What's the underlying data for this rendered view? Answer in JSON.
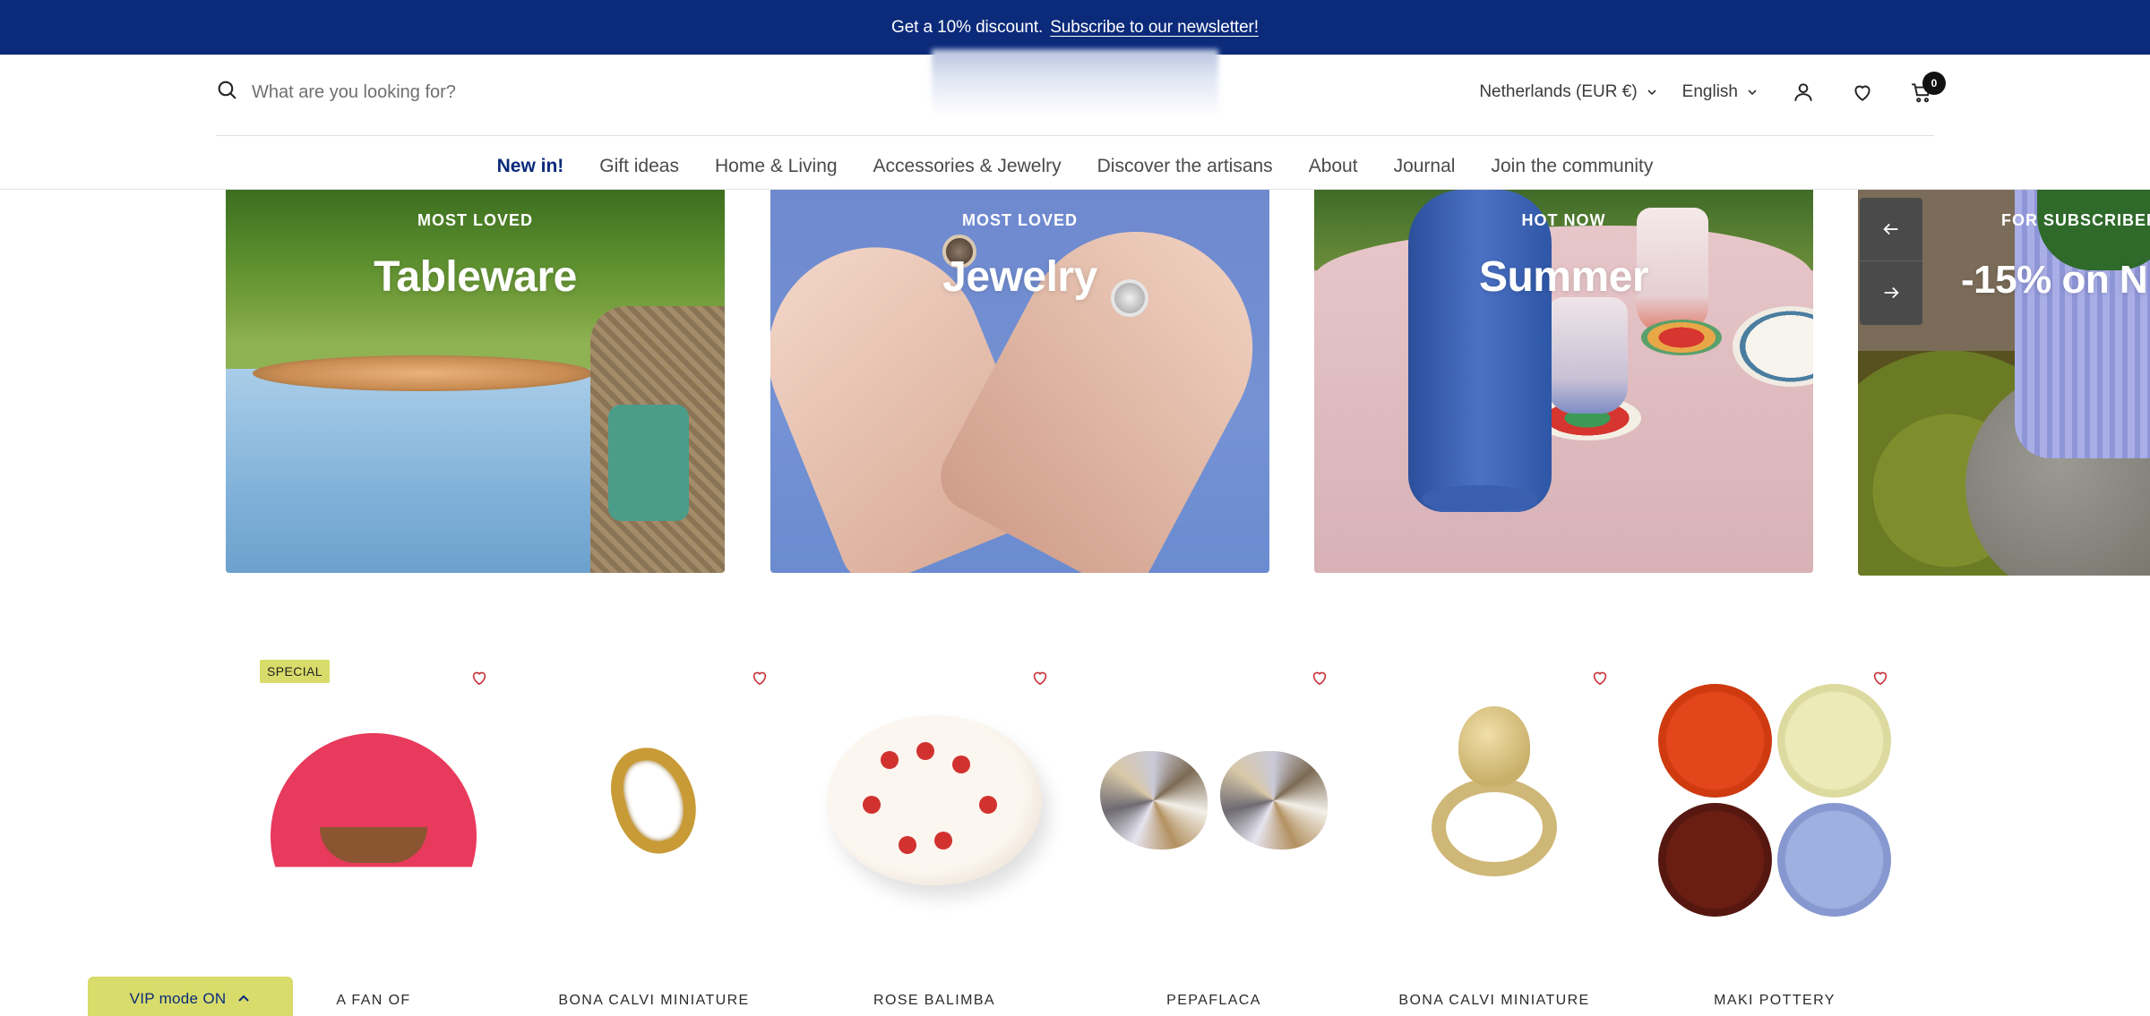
{
  "announcement": {
    "text": "Get a 10% discount.",
    "link": "Subscribe to our newsletter!"
  },
  "header": {
    "search_placeholder": "What are you looking for?",
    "country_selector": "Netherlands (EUR €)",
    "language_selector": "English",
    "cart_count": "0",
    "icons": [
      "search-icon",
      "chevron-down-icon",
      "account-icon",
      "heart-icon",
      "cart-icon"
    ]
  },
  "nav": {
    "items": [
      {
        "label": "New in!",
        "active": true
      },
      {
        "label": "Gift ideas"
      },
      {
        "label": "Home & Living"
      },
      {
        "label": "Accessories & Jewelry"
      },
      {
        "label": "Discover the artisans"
      },
      {
        "label": "About"
      },
      {
        "label": "Journal"
      },
      {
        "label": "Join the community"
      }
    ]
  },
  "hero": {
    "slides": [
      {
        "eyebrow": "MOST LOVED",
        "title": "Tableware"
      },
      {
        "eyebrow": "MOST LOVED",
        "title": "Jewelry"
      },
      {
        "eyebrow": "HOT NOW",
        "title": "Summer"
      },
      {
        "eyebrow": "FOR SUBSCRIBER",
        "title": "-15% on N"
      }
    ],
    "controls": [
      "arrow-left-icon",
      "arrow-right-icon"
    ]
  },
  "products": [
    {
      "vendor": "A FAN OF",
      "badge": "SPECIAL"
    },
    {
      "vendor": "BONA CALVI MINIATURE"
    },
    {
      "vendor": "ROSE BALIMBA"
    },
    {
      "vendor": "PEPAFLACA"
    },
    {
      "vendor": "BONA CALVI MINIATURE"
    },
    {
      "vendor": "MAKI POTTERY"
    }
  ],
  "vip": {
    "label": "VIP mode ON"
  },
  "colors": {
    "brand_navy": "#0b2a7a",
    "accent_yellow": "#d8dc6a",
    "wishlist_red": "#c8343b"
  }
}
